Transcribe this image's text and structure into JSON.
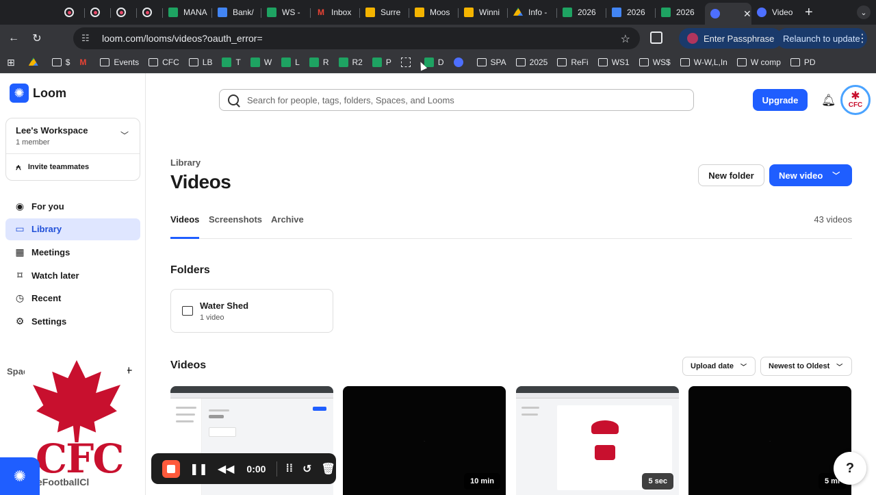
{
  "browser": {
    "tabs": [
      {
        "icon": "record-icon",
        "label": ""
      },
      {
        "icon": "record-icon",
        "label": ""
      },
      {
        "icon": "record-icon",
        "label": ""
      },
      {
        "icon": "record-icon",
        "label": ""
      },
      {
        "icon": "sheets-icon",
        "label": "MANA"
      },
      {
        "icon": "docs-icon",
        "label": "Bank/"
      },
      {
        "icon": "sheets-icon",
        "label": "WS - "
      },
      {
        "icon": "gmail-icon",
        "label": "Inbox"
      },
      {
        "icon": "slides-icon",
        "label": "Surre"
      },
      {
        "icon": "slides-icon",
        "label": "Moos"
      },
      {
        "icon": "slides-icon",
        "label": "Winni"
      },
      {
        "icon": "drive-icon",
        "label": "Info - "
      },
      {
        "icon": "sheets-icon",
        "label": "2026"
      },
      {
        "icon": "docs-icon",
        "label": "2026"
      },
      {
        "icon": "sheets-icon",
        "label": "2026"
      },
      {
        "icon": "loom-icon",
        "label": ""
      },
      {
        "icon": "loom-icon",
        "label": "Video"
      }
    ],
    "url": "loom.com/looms/videos?oauth_error=",
    "passphrase_label": "Enter Passphrase",
    "relaunch_label": "Relaunch to update",
    "bookmarks": [
      {
        "icon": "drive",
        "label": ""
      },
      {
        "icon": "folder",
        "label": "$"
      },
      {
        "icon": "gmail",
        "label": ""
      },
      {
        "icon": "folder",
        "label": "Events"
      },
      {
        "icon": "folder",
        "label": "CFC"
      },
      {
        "icon": "folder",
        "label": "LB"
      },
      {
        "icon": "sheet",
        "label": "T"
      },
      {
        "icon": "sheet",
        "label": "W"
      },
      {
        "icon": "sheet",
        "label": "L"
      },
      {
        "icon": "sheet",
        "label": "R"
      },
      {
        "icon": "sheet",
        "label": "R2"
      },
      {
        "icon": "sheet",
        "label": "P"
      },
      {
        "icon": "grid",
        "label": ""
      },
      {
        "icon": "sheet",
        "label": "D"
      },
      {
        "icon": "loom",
        "label": ""
      },
      {
        "icon": "folder",
        "label": "SPA"
      },
      {
        "icon": "folder",
        "label": "2025"
      },
      {
        "icon": "folder",
        "label": "ReFi"
      },
      {
        "icon": "folder",
        "label": "WS1"
      },
      {
        "icon": "folder",
        "label": "WS$"
      },
      {
        "icon": "folder",
        "label": "W-W,L,In"
      },
      {
        "icon": "folder",
        "label": "W comp"
      },
      {
        "icon": "folder",
        "label": "PD"
      }
    ]
  },
  "app": {
    "brand": "Loom",
    "workspace": {
      "name": "Lee's Workspace",
      "members": "1 member",
      "invite_label": "Invite teammates"
    },
    "nav": [
      {
        "label": "For you",
        "icon": "person-icon"
      },
      {
        "label": "Library",
        "icon": "library-icon"
      },
      {
        "label": "Meetings",
        "icon": "calendar-icon"
      },
      {
        "label": "Watch later",
        "icon": "bookmark-icon"
      },
      {
        "label": "Recent",
        "icon": "clock-icon"
      },
      {
        "label": "Settings",
        "icon": "gear-icon"
      }
    ],
    "spaces_label": "Spac"
  },
  "header": {
    "search_placeholder": "Search for people, tags, folders, Spaces, and Looms",
    "upgrade_label": "Upgrade",
    "avatar_text": "CFC"
  },
  "main": {
    "breadcrumb": "Library",
    "title": "Videos",
    "new_folder_label": "New folder",
    "new_video_label": "New video",
    "tabs": [
      {
        "label": "Videos",
        "active": true
      },
      {
        "label": "Screenshots",
        "active": false
      },
      {
        "label": "Archive",
        "active": false
      }
    ],
    "video_count": "43 videos",
    "folders_heading": "Folders",
    "folders": [
      {
        "name": "Water Shed",
        "count": "1 video"
      }
    ],
    "videos_heading": "Videos",
    "sort_field_label": "Upload date",
    "sort_order_label": "Newest to Oldest",
    "videos": [
      {
        "duration": "",
        "thumb": "screenshot"
      },
      {
        "duration": "10 min",
        "thumb": "dark"
      },
      {
        "duration": "5 sec",
        "thumb": "screenshot"
      },
      {
        "duration": "5 mi",
        "thumb": "dark"
      }
    ]
  },
  "recorder": {
    "time": "0:00",
    "cam_text": "CFC",
    "cam_subtext": "eFootballCl"
  },
  "help_label": "?",
  "colors": {
    "accent": "#1f5eff",
    "active_nav_bg": "#dfe6ff",
    "record_stop": "#ff5a3c",
    "cfc_red": "#c8102e"
  }
}
